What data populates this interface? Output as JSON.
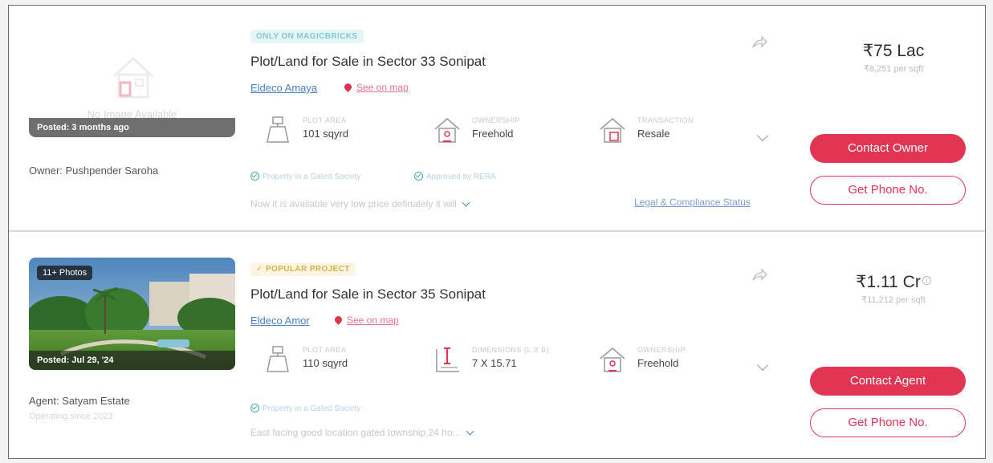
{
  "listings": [
    {
      "tag": "ONLY ON MAGICBRICKS",
      "title": "Plot/Land for Sale in Sector 33 Sonipat",
      "project": "Eldeco Amaya",
      "see_on_map": "See on map",
      "no_image_text": "No Image Available",
      "posted": "Posted: 3 months ago",
      "owner": "Owner: Pushpender Saroha",
      "stats": [
        {
          "label": "PLOT AREA",
          "value": "101 sqyrd",
          "icon": "plot-area-icon"
        },
        {
          "label": "OWNERSHIP",
          "value": "Freehold",
          "icon": "house-icon"
        },
        {
          "label": "TRANSACTION",
          "value": "Resale",
          "icon": "transaction-icon"
        }
      ],
      "chips": [
        "Property in a Gated Society",
        "Approved by RERA"
      ],
      "description": "Now it is available very low price definately it will",
      "legal_link": "Legal & Compliance Status",
      "price": "₹75 Lac",
      "price_per_sqft": "₹8,251 per sqft",
      "primary_button": "Contact Owner",
      "secondary_button": "Get Phone No."
    },
    {
      "tag": "✓ POPULAR PROJECT",
      "title": "Plot/Land for Sale in Sector 35 Sonipat",
      "project": "Eldeco Amor",
      "see_on_map": "See on map",
      "photo_count": "11+ Photos",
      "posted": "Posted: Jul 29, '24",
      "owner": "Agent: Satyam Estate",
      "operating": "Operating since 2023",
      "stats": [
        {
          "label": "PLOT AREA",
          "value": "110 sqyrd",
          "icon": "plot-area-icon"
        },
        {
          "label": "DIMENSIONS (L X B)",
          "value": "7 X 15.71",
          "icon": "dimensions-icon"
        },
        {
          "label": "OWNERSHIP",
          "value": "Freehold",
          "icon": "house-icon"
        }
      ],
      "chips": [
        "Property in a Gated Society"
      ],
      "description": "East facing good location gated township,24 ho...",
      "price": "₹1.11 Cr",
      "price_per_sqft": "₹11,212 per sqft",
      "primary_button": "Contact Agent",
      "secondary_button": "Get Phone No."
    }
  ],
  "colors": {
    "brand_red": "#e23453",
    "link_blue": "#4a7fc7",
    "tag_teal": "#7fcad0",
    "tag_gold": "#d9b24c"
  }
}
